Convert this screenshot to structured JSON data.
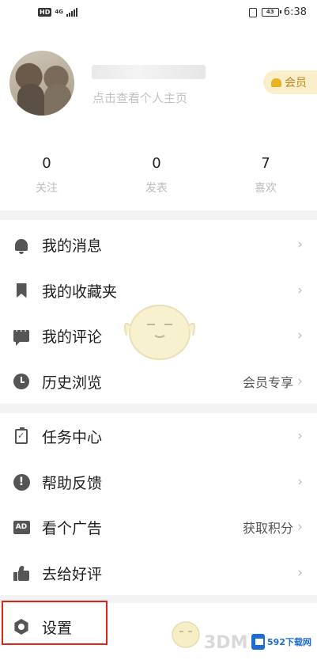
{
  "status_bar": {
    "hd": "HD",
    "network": "4G",
    "battery": "43",
    "time": "6:38"
  },
  "profile": {
    "username": "",
    "hint": "点击查看个人主页",
    "vip_label": "会员"
  },
  "stats": [
    {
      "value": "0",
      "label": "关注"
    },
    {
      "value": "0",
      "label": "发表"
    },
    {
      "value": "7",
      "label": "喜欢"
    }
  ],
  "menu_group_1": [
    {
      "label": "我的消息",
      "icon": "bell-icon",
      "extra": ""
    },
    {
      "label": "我的收藏夹",
      "icon": "bookmark-icon",
      "extra": ""
    },
    {
      "label": "我的评论",
      "icon": "comment-icon",
      "extra": ""
    },
    {
      "label": "历史浏览",
      "icon": "clock-icon",
      "extra": "会员专享"
    }
  ],
  "menu_group_2": [
    {
      "label": "任务中心",
      "icon": "task-icon",
      "extra": ""
    },
    {
      "label": "帮助反馈",
      "icon": "help-icon",
      "extra": ""
    },
    {
      "label": "看个广告",
      "icon": "ad-icon",
      "extra": "获取积分"
    },
    {
      "label": "去给好评",
      "icon": "thumbs-up-icon",
      "extra": ""
    },
    {
      "label": "设置",
      "icon": "gear-icon",
      "extra": ""
    }
  ],
  "watermark": {
    "text": "3DM",
    "site": "592下载网"
  },
  "colors": {
    "highlight": "#e0241b",
    "vip_bg": "#fbeeca",
    "vip_text": "#b88a1d",
    "separator": "#f3f3f3"
  }
}
